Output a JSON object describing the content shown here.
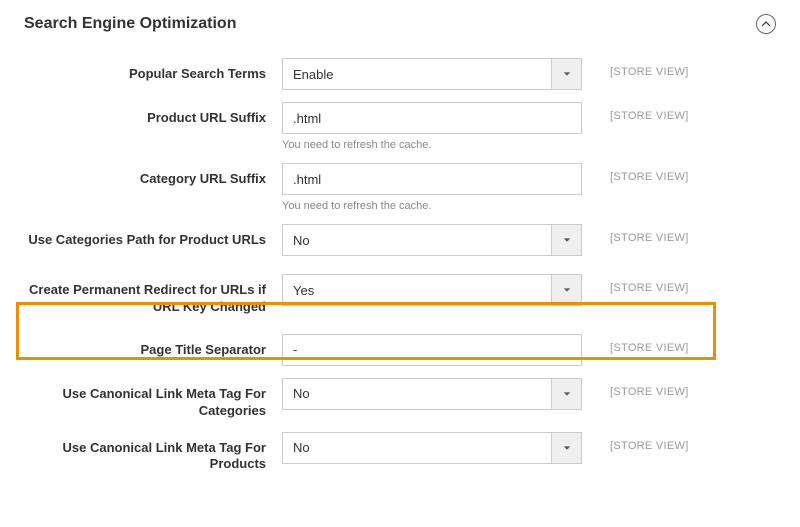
{
  "section": {
    "title": "Search Engine Optimization"
  },
  "scope_label": "[STORE VIEW]",
  "fields": {
    "popular_search_terms": {
      "label": "Popular Search Terms",
      "value": "Enable"
    },
    "product_url_suffix": {
      "label": "Product URL Suffix",
      "value": ".html",
      "helper": "You need to refresh the cache."
    },
    "category_url_suffix": {
      "label": "Category URL Suffix",
      "value": ".html",
      "helper": "You need to refresh the cache."
    },
    "use_categories_path": {
      "label": "Use Categories Path for Product URLs",
      "value": "No"
    },
    "permanent_redirect": {
      "label": "Create Permanent Redirect for URLs if URL Key Changed",
      "value": "Yes"
    },
    "page_title_separator": {
      "label": "Page Title Separator",
      "value": "-"
    },
    "canonical_categories": {
      "label": "Use Canonical Link Meta Tag For Categories",
      "value": "No"
    },
    "canonical_products": {
      "label": "Use Canonical Link Meta Tag For Products",
      "value": "No"
    }
  }
}
